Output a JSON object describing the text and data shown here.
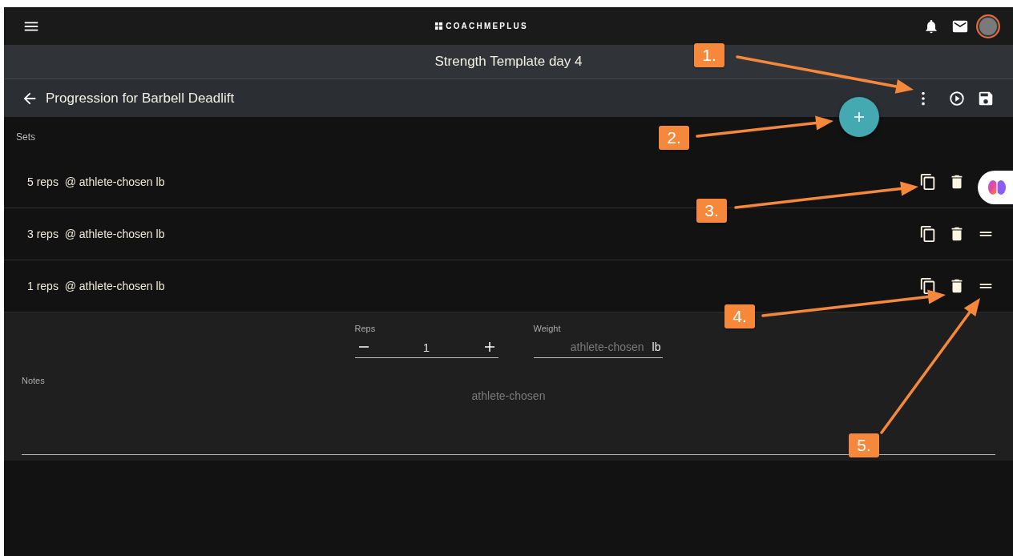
{
  "app_bar": {
    "logo_text": "COACHMEPLUS"
  },
  "page_title": "Strength Template day 4",
  "toolbar": {
    "title": "Progression for Barbell Deadlift"
  },
  "section_label": "Sets",
  "sets": [
    {
      "label": "5 reps  @ athlete-chosen lb",
      "expanded": false,
      "drag_handle": false
    },
    {
      "label": "3 reps  @ athlete-chosen lb",
      "expanded": false,
      "drag_handle": true
    },
    {
      "label": "1 reps  @ athlete-chosen lb",
      "expanded": true,
      "drag_handle": true
    }
  ],
  "editor": {
    "reps": {
      "label": "Reps",
      "value": "1"
    },
    "weight": {
      "label": "Weight",
      "placeholder": "athlete-chosen",
      "unit": "lb"
    },
    "notes": {
      "label": "Notes",
      "placeholder": "athlete-chosen"
    }
  },
  "annotations": [
    {
      "label": "1."
    },
    {
      "label": "2."
    },
    {
      "label": "3."
    },
    {
      "label": "4."
    },
    {
      "label": "5."
    }
  ]
}
